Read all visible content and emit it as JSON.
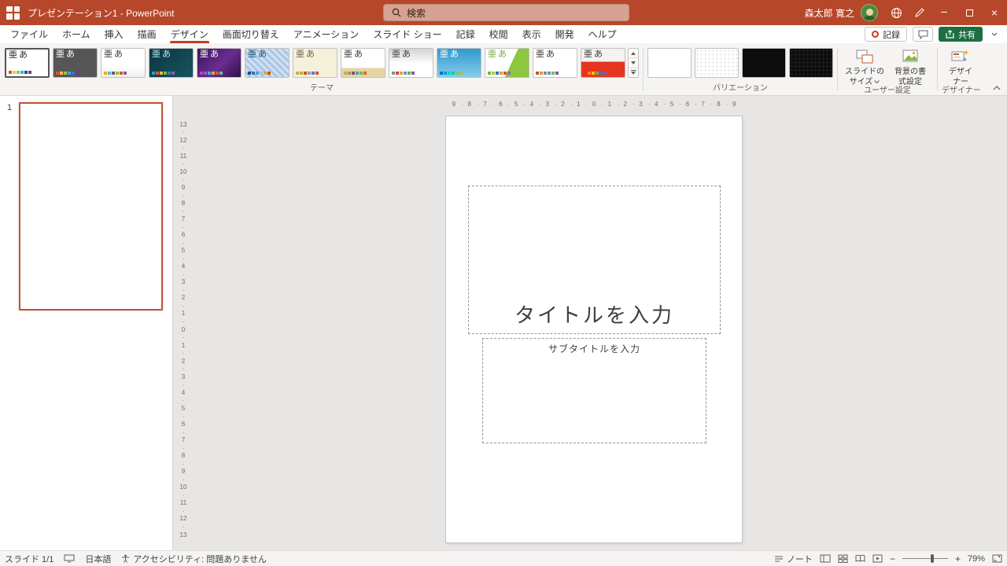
{
  "titlebar": {
    "title": "プレゼンテーション1 - PowerPoint",
    "search_placeholder": "検索",
    "user_name": "森太郎 寛之"
  },
  "icons": {
    "minimize": "–",
    "close": "×",
    "zoom_in": "+",
    "zoom_out": "−"
  },
  "menubar": {
    "tabs": [
      {
        "label": "ファイル"
      },
      {
        "label": "ホーム"
      },
      {
        "label": "挿入"
      },
      {
        "label": "描画"
      },
      {
        "label": "デザイン",
        "active": true
      },
      {
        "label": "画面切り替え"
      },
      {
        "label": "アニメーション"
      },
      {
        "label": "スライド ショー"
      },
      {
        "label": "記録"
      },
      {
        "label": "校閲"
      },
      {
        "label": "表示"
      },
      {
        "label": "開発"
      },
      {
        "label": "ヘルプ"
      }
    ],
    "record_label": "記録",
    "share_label": "共有"
  },
  "ribbon": {
    "sample_text": "亜あ",
    "themes": [
      {
        "selected": true,
        "bg": "#ffffff",
        "fg": "#262626",
        "strip": [
          "#e84c22",
          "#ffbd47",
          "#a2c636",
          "#26b4ec",
          "#1b587c",
          "#6b3c94"
        ]
      },
      {
        "bg": "#565656",
        "fg": "#ffffff",
        "strip": [
          "#e84c22",
          "#ffbd47",
          "#a2c636",
          "#26b4ec",
          "#4472c4",
          "#6b3c94"
        ]
      },
      {
        "bg": "linear-gradient(#ffffff 62%,#efeeec)",
        "fg": "#3b3b3b",
        "strip": [
          "#f0ad00",
          "#60b5cc",
          "#5a6378",
          "#95c11f",
          "#d9534f",
          "#7b5aa6"
        ]
      },
      {
        "bg": "linear-gradient(135deg,#0c3743,#17545f)",
        "fg": "#ade8ef",
        "strip": [
          "#2da2bf",
          "#da5d2b",
          "#ebb54d",
          "#7fb543",
          "#4472c4",
          "#8b5ba5"
        ]
      },
      {
        "bg": "linear-gradient(135deg,#3a175c,#6b2d90 55%,#2c1045)",
        "fg": "#ffffff",
        "strip": [
          "#b84aa3",
          "#7f62c9",
          "#4ea6dc",
          "#e2a33d",
          "#d9534f",
          "#64c1a4"
        ]
      },
      {
        "bg": "repeating-linear-gradient(45deg,#cfe0f1 0 3px,#a8c6e4 3px 6px)",
        "fg": "#1f4e79",
        "strip": [
          "#1f4e79",
          "#2e75b6",
          "#5b9bd5",
          "#9dc3e6",
          "#e2a33d",
          "#c55a11"
        ]
      },
      {
        "bg": "#f5f0d9",
        "fg": "#6b6547",
        "strip": [
          "#a3b86c",
          "#e0a025",
          "#b85c1f",
          "#7aa6ca",
          "#8b6bb0",
          "#c9544e"
        ]
      },
      {
        "bg": "linear-gradient(#ffffff 68%,#e6d4a5 68%)",
        "fg": "#3b3b3b",
        "strip": [
          "#c8a860",
          "#a28e6a",
          "#726056",
          "#4a9ccc",
          "#85b74a",
          "#d26b32"
        ]
      },
      {
        "bg": "linear-gradient(#d6d4d2,#ffffff 55%)",
        "fg": "#404040",
        "strip": [
          "#8c8c8c",
          "#d34836",
          "#e8a33d",
          "#5b9bd5",
          "#70ad47",
          "#7b5aa6"
        ]
      },
      {
        "bg": "linear-gradient(#2f9ad0,#86cbe9)",
        "fg": "#ffffff",
        "strip": [
          "#0f6fc6",
          "#009dd9",
          "#0bd0d9",
          "#10cf9b",
          "#7cca62",
          "#a5c249"
        ]
      },
      {
        "bg": "linear-gradient(115deg,#ffffff 58%,#8dc63f 58%)",
        "fg": "#76b043",
        "strip": [
          "#76b043",
          "#a2cf4e",
          "#2e75b6",
          "#e0a025",
          "#c9544e",
          "#8b6bb0"
        ]
      },
      {
        "bg": "#ffffff",
        "fg": "#3b3b3b",
        "strip": [
          "#b85c1f",
          "#d99748",
          "#8c8c8c",
          "#4a9ccc",
          "#85b74a",
          "#7b5aa6"
        ]
      },
      {
        "bg": "linear-gradient(#f4f3f2 46%,#e5351f 46%)",
        "fg": "#3b3b3b",
        "strip": [
          "#e5351f",
          "#f07f29",
          "#ffc000",
          "#70ad47",
          "#4472c4",
          "#7b5aa6"
        ]
      }
    ],
    "themes_group_label": "テーマ",
    "variations": [
      {
        "bg": "#ffffff"
      },
      {
        "bg": "radial-gradient(#dcdcdc 0.8px,#ffffff 0.8px) 0 0/5px 5px"
      },
      {
        "bg": "#0c0c0c"
      },
      {
        "bg": "radial-gradient(#2e2e2e 0.8px,#0d0d0d 0.8px) 0 0/5px 5px"
      }
    ],
    "variations_group_label": "バリエーション",
    "slide_size": {
      "line1": "スライドの",
      "line2": "サイズ"
    },
    "bg_format": {
      "line1": "背景の書",
      "line2": "式設定"
    },
    "custom_group_label": "ユーザー設定",
    "designer": {
      "line1": "デザイ",
      "line2": "ナー"
    },
    "designer_group_label": "デザイナー"
  },
  "slides_panel": {
    "slide_number": "1"
  },
  "canvas": {
    "title_placeholder": "タイトルを入力",
    "subtitle_placeholder": "サブタイトルを入力",
    "h_ruler": [
      9,
      8,
      7,
      6,
      5,
      4,
      3,
      2,
      1,
      0,
      1,
      2,
      3,
      4,
      5,
      6,
      7,
      8,
      9
    ],
    "v_ruler": [
      13,
      12,
      11,
      10,
      9,
      8,
      7,
      6,
      5,
      4,
      3,
      2,
      1,
      0,
      1,
      2,
      3,
      4,
      5,
      6,
      7,
      8,
      9,
      10,
      11,
      12,
      13
    ]
  },
  "statusbar": {
    "slide_counter": "スライド 1/1",
    "language": "日本語",
    "accessibility": "アクセシビリティ: 問題ありません",
    "notes_label": "ノート",
    "zoom_percent": "79%"
  }
}
